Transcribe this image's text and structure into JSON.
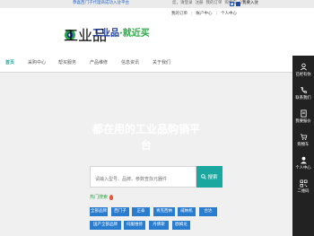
{
  "topbar": {
    "notice": "恭喜西门子代理商成功入驻平台",
    "links": [
      "您，请登录",
      "注册",
      "我的订单",
      "购物车"
    ],
    "cart_count": "0",
    "settle": "我要入驻"
  },
  "subbar": {
    "links": [
      "我的订单",
      "帐户中心",
      "个人中心"
    ]
  },
  "logo": {
    "small": "工业品",
    "main_a": "工业品",
    "main_b": "·就近买"
  },
  "nav": {
    "items": [
      "首页",
      "采购中心",
      "帮买服务",
      "产品维修",
      "信息资讯",
      "关于我们"
    ]
  },
  "hero": {
    "title_line1": "都在用的工业品购销平",
    "title_line2": "台"
  },
  "search": {
    "placeholder": "请输入型号、品牌、参数查找元器件",
    "button": "搜索"
  },
  "hot": {
    "label": "热门搜索"
  },
  "tags": {
    "row1": [
      "全部品牌",
      "西门子",
      "正泰",
      "青克西纳",
      "威纳机",
      "台达"
    ],
    "row2": [
      "国产全部品牌",
      "伺服维修",
      "丹佛斯",
      "欧姆龙"
    ]
  },
  "side": {
    "items": [
      "已经有你",
      "联系我们",
      "我要报价",
      "购物车",
      "个人中心",
      "二维码"
    ]
  },
  "colors": {
    "accent": "#1aa7a0",
    "brand": "#1a3d9a",
    "tag": "#2a7ccf",
    "side": "#222222"
  }
}
